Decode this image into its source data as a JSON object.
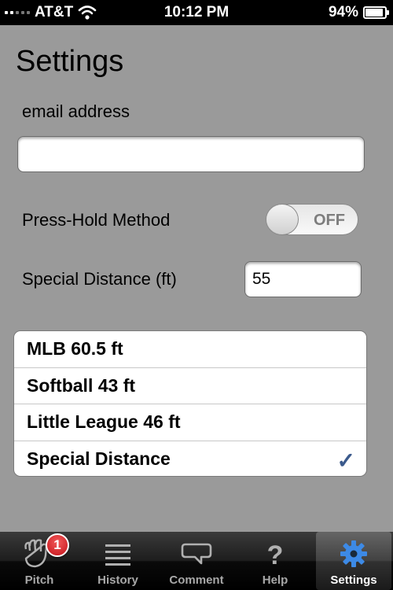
{
  "status_bar": {
    "carrier": "AT&T",
    "time": "10:12 PM",
    "battery": "94%",
    "battery_level": 0.94,
    "icons": [
      "signal-icon",
      "wifi-icon",
      "battery-icon"
    ]
  },
  "settings": {
    "title": "Settings",
    "email_label": "email address",
    "email_value": "",
    "press_hold_label": "Press-Hold Method",
    "press_hold_state": "OFF",
    "special_distance_label": "Special Distance (ft)",
    "special_distance_value": "55"
  },
  "distance_options": {
    "items": [
      {
        "label": "MLB 60.5 ft",
        "selected": false
      },
      {
        "label": "Softball 43 ft",
        "selected": false
      },
      {
        "label": "Little League 46 ft",
        "selected": false
      },
      {
        "label": "Special Distance",
        "selected": true
      }
    ],
    "check_color": "#3b5a8c"
  },
  "tab_bar": {
    "tabs": [
      {
        "label": "Pitch",
        "icon": "glove-icon",
        "badge": "1",
        "active": false
      },
      {
        "label": "History",
        "icon": "list-icon",
        "active": false
      },
      {
        "label": "Comment",
        "icon": "speech-bubble-icon",
        "active": false
      },
      {
        "label": "Help",
        "icon": "question-icon",
        "active": false
      },
      {
        "label": "Settings",
        "icon": "gear-icon",
        "active": true
      }
    ],
    "active_icon_color": "#3d8ae6"
  }
}
